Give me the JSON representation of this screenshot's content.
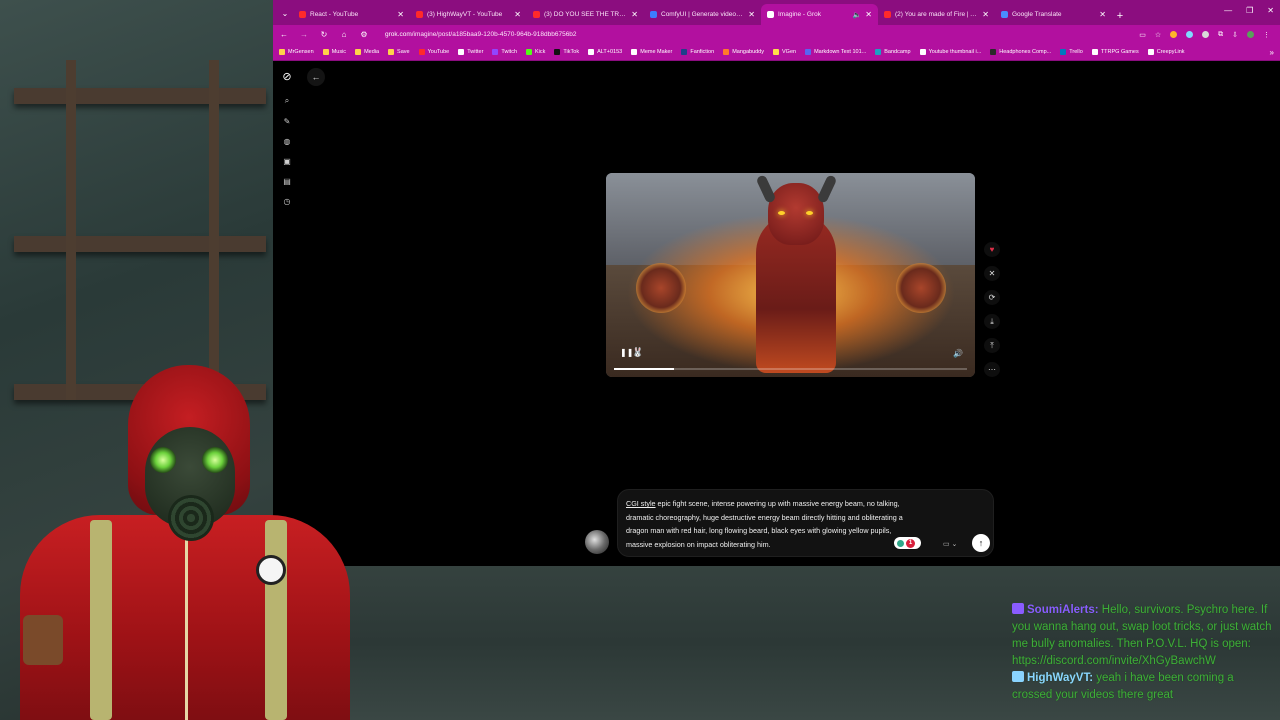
{
  "browser": {
    "tabs": [
      {
        "title": "React - YouTube",
        "color": "#ff2a2a",
        "active": false
      },
      {
        "title": "(3) HighWayVT - YouTube",
        "color": "#ff2a2a",
        "active": false
      },
      {
        "title": "(3) DO YOU SEE THE TRUTH? |",
        "color": "#ff2a2a",
        "active": false
      },
      {
        "title": "ComfyUI | Generate video, ima",
        "color": "#3c7cff",
        "active": false
      },
      {
        "title": "Imagine - Grok",
        "color": "#ffffff",
        "active": true
      },
      {
        "title": "(2) You are made of Fire | AI M",
        "color": "#ff2a2a",
        "active": false
      },
      {
        "title": "Google Translate",
        "color": "#4a8cff",
        "active": false
      }
    ],
    "url_host": "grok.com",
    "url_path": "/imagine/post/a185baa9-120b-4570-964b-918dbb6756b2",
    "bookmarks": [
      {
        "label": "MrGensen",
        "color": "#ffd34a"
      },
      {
        "label": "Music",
        "color": "#ffd34a"
      },
      {
        "label": "Media",
        "color": "#ffd34a"
      },
      {
        "label": "Save",
        "color": "#ffd34a"
      },
      {
        "label": "YouTube",
        "color": "#ff2a2a"
      },
      {
        "label": "Twitter",
        "color": "#ffffff"
      },
      {
        "label": "Twitch",
        "color": "#9146ff"
      },
      {
        "label": "Kick",
        "color": "#53fc18"
      },
      {
        "label": "TikTok",
        "color": "#111111"
      },
      {
        "label": "ALT+0153",
        "color": "#ffffff"
      },
      {
        "label": "Meme Maker",
        "color": "#ffffff"
      },
      {
        "label": "Fanfiction",
        "color": "#1f3f8a"
      },
      {
        "label": "Mangabuddy",
        "color": "#ff7a2a"
      },
      {
        "label": "VGen",
        "color": "#ffe14a"
      },
      {
        "label": "Markdown Text 101...",
        "color": "#5865f2"
      },
      {
        "label": "Bandcamp",
        "color": "#1da0c3"
      },
      {
        "label": "Youtube thumbnail i...",
        "color": "#ffffff"
      },
      {
        "label": "Headphones Comp...",
        "color": "#2a2a2a"
      },
      {
        "label": "Trello",
        "color": "#0079bf"
      },
      {
        "label": "TTRPG Games",
        "color": "#ffffff"
      },
      {
        "label": "CreepyLink",
        "color": "#ffffff"
      }
    ]
  },
  "grok": {
    "video": {
      "progress": 0.17
    },
    "prompt": {
      "highlight": "CGI style",
      "text": " epic fight scene, intense powering up with massive energy beam, no talking, dramatic choreography, huge destructive energy beam directly hitting and obliterating a dragon man with red hair, long flowing beard, black eyes with glowing yellow pupils, massive explosion on impact obliterating him."
    },
    "badge_count": "1"
  },
  "chat": [
    {
      "user": "SoumiAlerts:",
      "text": " Hello, survivors. Psychro here. If you wanna hang out, swap loot tricks, or just watch me bully anomalies. Then P.O.V.L. HQ is open: https://discord.com/invite/XhGyBawchW",
      "color": "#8a5cff"
    },
    {
      "user": "HighWayVT:",
      "text": " yeah i have been coming a crossed your videos there great",
      "color": "#8ad4ff"
    }
  ]
}
